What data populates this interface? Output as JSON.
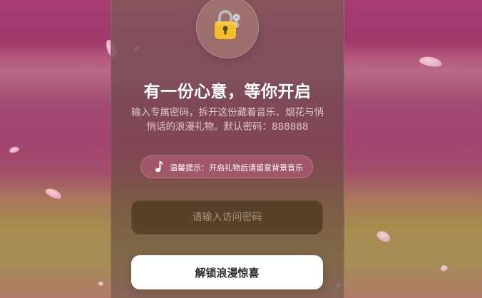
{
  "unlock": {
    "title": "有一份心意，等你开启",
    "description": "输入专属密码，拆开这份藏着音乐、烟花与悄悄话的浪漫礼物。默认密码：888888",
    "tip": "温馨提示：开启礼物后请留意背景音乐",
    "password_placeholder": "请输入访问密码",
    "password_value": "",
    "submit_label": "解锁浪漫惊喜"
  },
  "icons": {
    "lock": "lock-icon",
    "music": "music-note-icon"
  },
  "colors": {
    "lock_body": "#f4c02a",
    "button_bg": "#ffffff",
    "pill_bg": "#be607e"
  }
}
